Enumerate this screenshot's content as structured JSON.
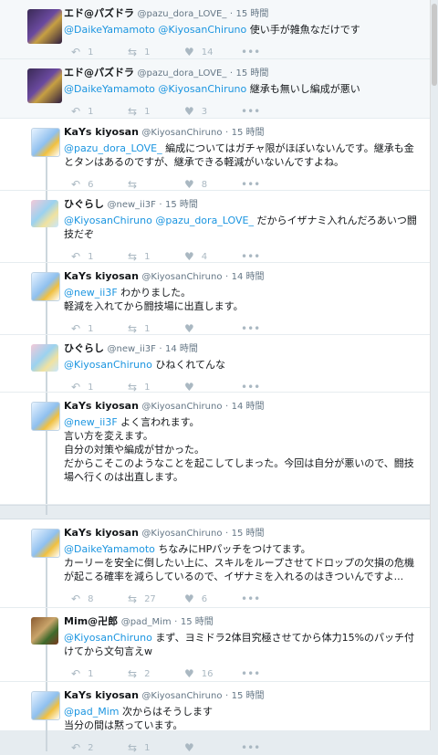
{
  "tweets": [
    {
      "name": "エド@パズドラ",
      "handle": "@pazu_dora_LOVE_",
      "time": "15 時間",
      "m1": "@DaikeYamamoto",
      "m2": "@KiyosanChiruno",
      "text": " 使い手が雑魚なだけです",
      "reply": "1",
      "rt": "1",
      "like": "14"
    },
    {
      "name": "エド@パズドラ",
      "handle": "@pazu_dora_LOVE_",
      "time": "15 時間",
      "m1": "@DaikeYamamoto",
      "m2": "@KiyosanChiruno",
      "text": " 継承も無いし編成が悪い",
      "reply": "1",
      "rt": "1",
      "like": "3"
    },
    {
      "name": "KaYs kiyosan",
      "handle": "@KiyosanChiruno",
      "time": "15 時間",
      "m1": "@pazu_dora_LOVE_",
      "text": " 編成についてはガチャ限がほぼいないんです。継承も金とタンはあるのですが、継承できる軽減がいないんですよね。",
      "reply": "6",
      "rt": "",
      "like": "8"
    },
    {
      "name": "ひぐらし",
      "handle": "@new_ii3F",
      "time": "15 時間",
      "m1": "@KiyosanChiruno",
      "m2": "@pazu_dora_LOVE_",
      "text": " だからイザナミ入れんだろあいつ闘技だぞ",
      "reply": "1",
      "rt": "1",
      "like": "4"
    },
    {
      "name": "KaYs kiyosan",
      "handle": "@KiyosanChiruno",
      "time": "14 時間",
      "m1": "@new_ii3F",
      "text": " わかりました。\n軽減を入れてから闘技場に出直します。",
      "reply": "1",
      "rt": "1",
      "like": ""
    },
    {
      "name": "ひぐらし",
      "handle": "@new_ii3F",
      "time": "14 時間",
      "m1": "@KiyosanChiruno",
      "text": " ひねくれてんな",
      "reply": "1",
      "rt": "1",
      "like": ""
    },
    {
      "name": "KaYs kiyosan",
      "handle": "@KiyosanChiruno",
      "time": "14 時間",
      "m1": "@new_ii3F",
      "text": " よく言われます。\n言い方を変えます。\n自分の対策や編成が甘かった。\nだからこそこのようなことを起こしてしまった。今回は自分が悪いので、闘技場へ行くのは出直します。",
      "reply": "1",
      "rt": "1",
      "like": ""
    },
    {
      "name": "KaYs kiyosan",
      "handle": "@KiyosanChiruno",
      "time": "15 時間",
      "m1": "@DaikeYamamoto",
      "text": " ちなみにHPパッチをつけてます。\nカーリーを安全に倒したい上に、スキルをループさせてドロップの欠損の危機が起こる確率を減らしているので、イザナミを入れるのはきついんですよ...",
      "reply": "8",
      "rt": "27",
      "like": "6"
    },
    {
      "name": "Mim@卍郎",
      "handle": "@pad_Mim",
      "time": "15 時間",
      "m1": "@KiyosanChiruno",
      "text": " まず、ヨミドラ2体目究極させてから体力15%のパッチ付けてから文句言えw",
      "reply": "1",
      "rt": "2",
      "like": "16"
    },
    {
      "name": "KaYs kiyosan",
      "handle": "@KiyosanChiruno",
      "time": "15 時間",
      "m1": "@pad_Mim",
      "text": " 次からはそうします\n当分の間は黙っています。",
      "reply": "2",
      "rt": "1",
      "like": ""
    }
  ]
}
